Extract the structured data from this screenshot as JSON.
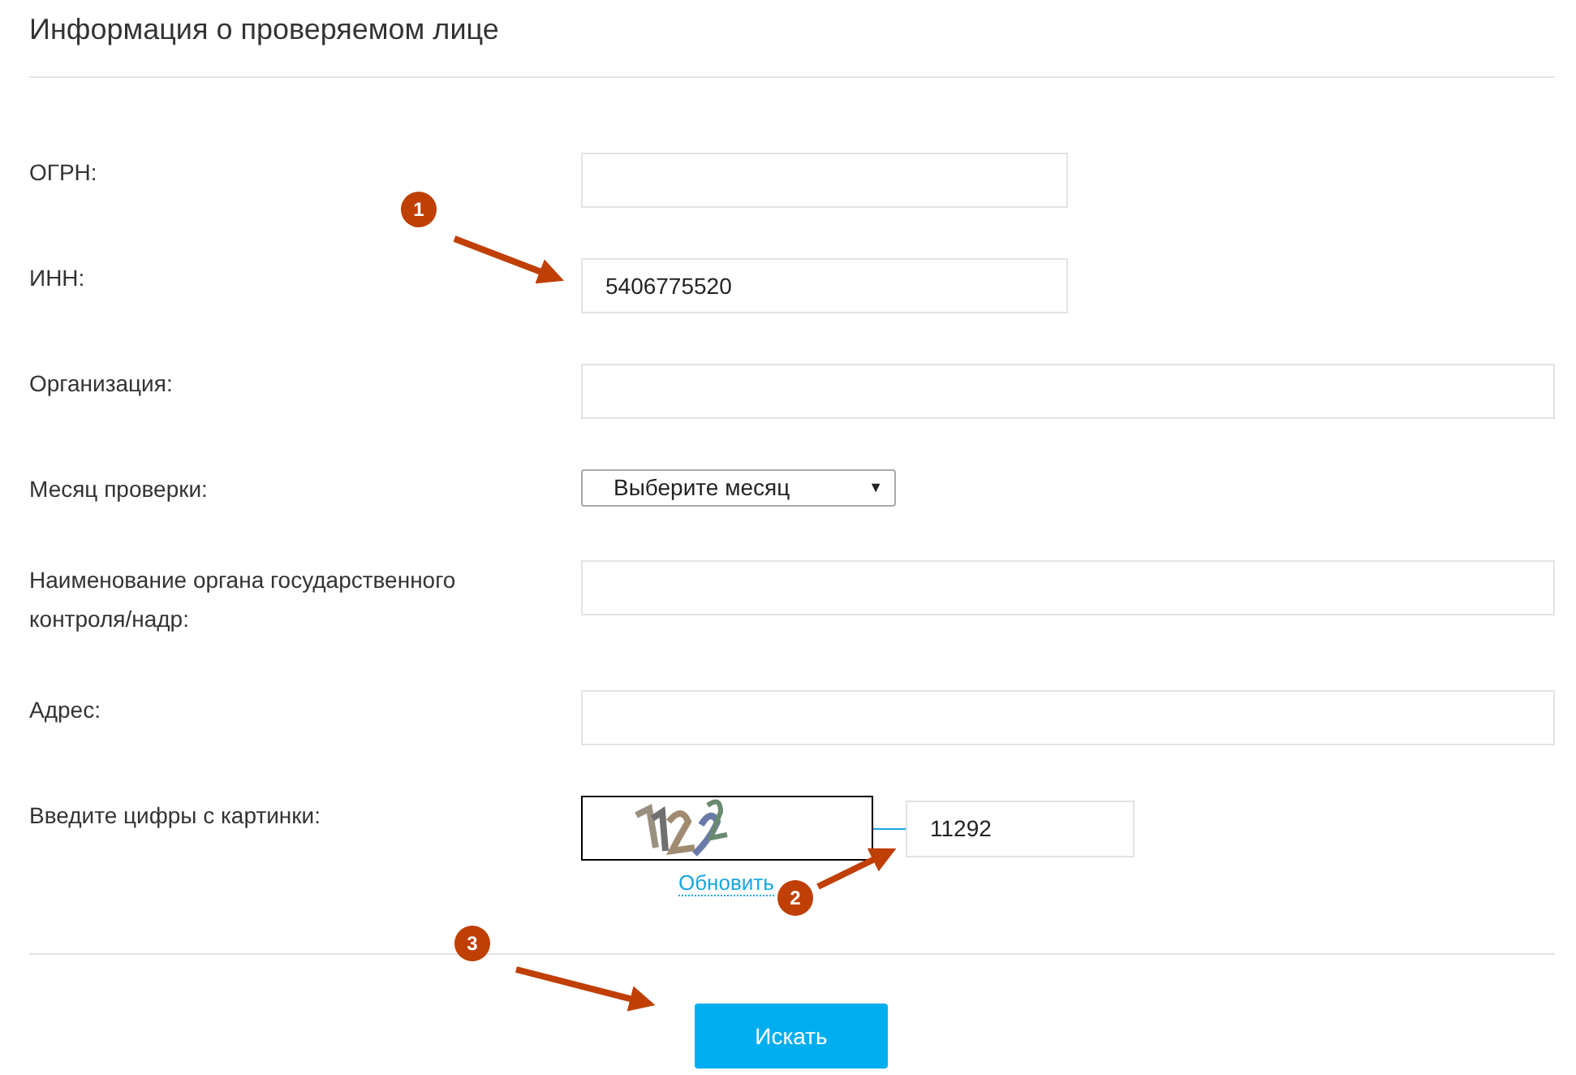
{
  "title": "Информация о проверяемом лице",
  "rows": [
    {
      "label": "ОГРН:",
      "kind": "field_short"
    },
    {
      "label": "ИНН:",
      "kind": "field_short",
      "value": "5406775520"
    },
    {
      "label": "Организация:",
      "kind": "field_wide"
    },
    {
      "label": "Месяц проверки:",
      "kind": "select",
      "value": "Выберите месяц",
      "arrow": "▼"
    },
    {
      "label": "Наименование органа государственного контроля/надр:",
      "kind": "field_wide"
    },
    {
      "label": "Адрес:",
      "kind": "field_wide"
    },
    {
      "label": "Введите цифры с картинки:",
      "kind": "captcha",
      "link": "Обновить",
      "value": "11292"
    }
  ],
  "button": "Искать",
  "annotations": [
    {
      "label": "1"
    },
    {
      "label": "2"
    },
    {
      "label": "3"
    }
  ]
}
